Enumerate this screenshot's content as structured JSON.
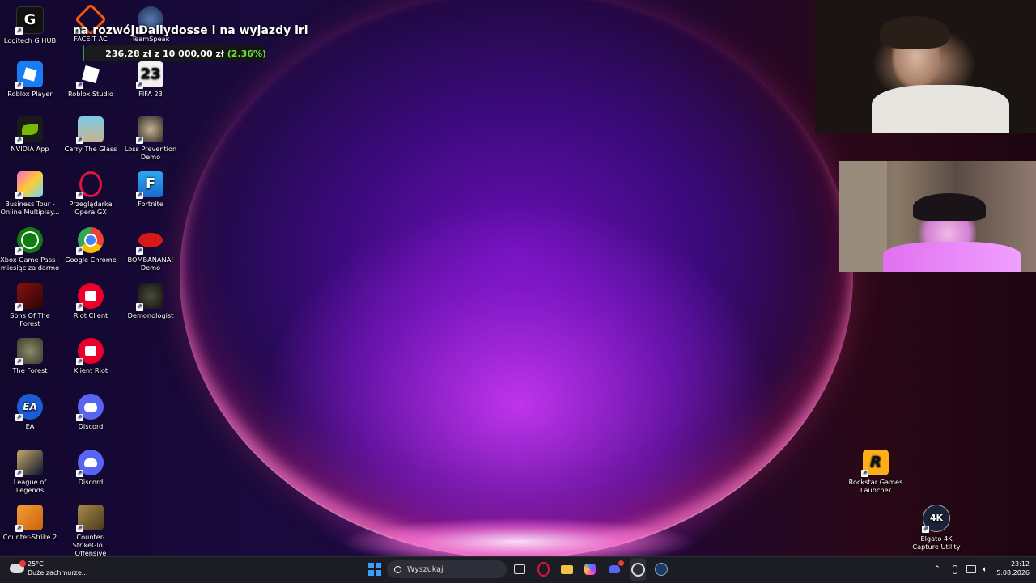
{
  "colors": {
    "accent": "#6be33a",
    "taskbar_bg": "#1c1c24",
    "wallpaper_glow": "#d63cff"
  },
  "banner": {
    "title": "na rozwój Dailydosse i na wyjazdy irl",
    "amount": "236,28 zł",
    "of": "z",
    "goal": "10 000,00 zł",
    "percent": "(2.36%)",
    "progress_fraction": 0.0236
  },
  "desktop_icons": {
    "logitech": "Logitech G HUB",
    "faceit": "FACEIT AC",
    "teamspeak": "TeamSpeak",
    "roblox_player": "Roblox Player",
    "roblox_studio": "Roblox Studio",
    "fifa": "FIFA 23",
    "fifa_badge": "23",
    "nvidia": "NVIDIA App",
    "carry_glass": "Carry The Glass",
    "loss_prevention": "Loss Prevention Demo",
    "business_tour": "Business Tour - Online Multiplay...",
    "opera_gx": "Przeglądarka Opera GX",
    "fortnite": "Fortnite",
    "fortnite_badge": "F",
    "xbox_pass": "Xbox Game Pass - miesiąc za darmo",
    "chrome": "Google Chrome",
    "bombanana": "BOMBANANA! Demo",
    "sons_forest": "Sons Of The Forest",
    "riot_client": "Riot Client",
    "demonologist": "Demonologist",
    "the_forest": "The Forest",
    "klient_riot": "Klient Riot",
    "ea": "EA",
    "ea_badge": "EA",
    "discord1": "Discord",
    "lol": "League of Legends",
    "discord2": "Discord",
    "cs2": "Counter-Strike 2",
    "csgo": "Counter-StrikeGlo... Offensive",
    "rockstar": "Rockstar Games Launcher",
    "rockstar_badge": "R",
    "elgato": "Elgato 4K Capture Utility",
    "elgato_badge": "4K"
  },
  "taskbar": {
    "weather_temp": "25°C",
    "weather_desc": "Duże zachmurze...",
    "search_placeholder": "Wyszukaj",
    "time": "23:12",
    "date": "5.08.2026"
  }
}
